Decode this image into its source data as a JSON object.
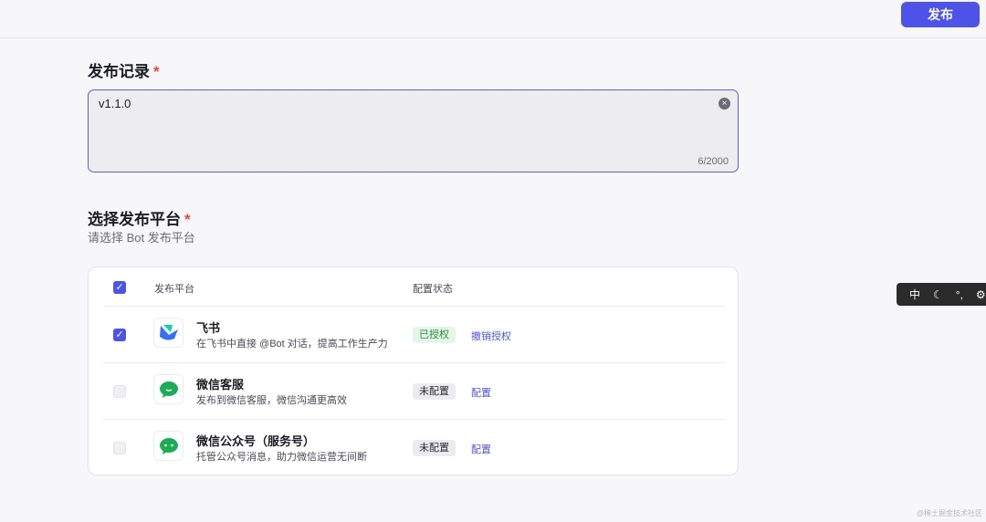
{
  "header": {
    "publish_label": "发布"
  },
  "release_notes": {
    "label": "发布记录",
    "required": "*",
    "value": "v1.1.0",
    "counter": "6/2000"
  },
  "platforms": {
    "label": "选择发布平台",
    "required": "*",
    "subtitle": "请选择 Bot 发布平台",
    "columns": [
      "发布平台",
      "配置状态"
    ],
    "rows": [
      {
        "name": "飞书",
        "desc": "在飞书中直接 @Bot 对话，提高工作生产力",
        "status": "已授权",
        "action": "撤销授权",
        "checked": true
      },
      {
        "name": "微信客服",
        "desc": "发布到微信客服，微信沟通更高效",
        "status": "未配置",
        "action": "配置",
        "checked": false
      },
      {
        "name": "微信公众号（服务号）",
        "desc": "托管公众号消息，助力微信运营无间断",
        "status": "未配置",
        "action": "配置",
        "checked": false
      }
    ]
  },
  "ime": {
    "mode": "中",
    "punct": "°,"
  },
  "watermark": "@稀土掘金技术社区",
  "colors": {
    "accent": "#4d53e8",
    "wechat": "#1aad53"
  }
}
